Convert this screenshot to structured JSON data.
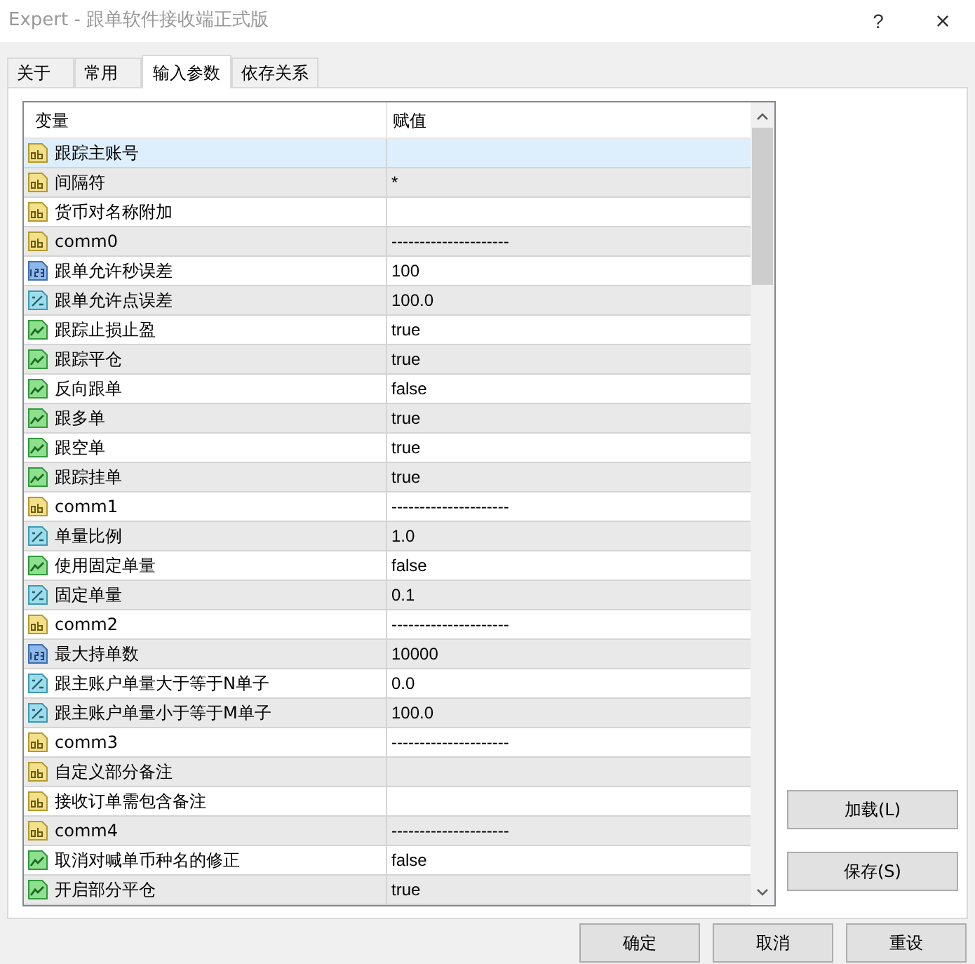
{
  "window": {
    "title": "Expert - 跟单软件接收端正式版",
    "help": "?",
    "close": "×"
  },
  "tabs": [
    {
      "label": "关于",
      "selected": false
    },
    {
      "label": "常用",
      "selected": false
    },
    {
      "label": "输入参数",
      "selected": true
    },
    {
      "label": "依存关系",
      "selected": false
    }
  ],
  "table": {
    "columns": [
      "变量",
      "赋值"
    ],
    "rows": [
      {
        "kind": "string",
        "name": "跟踪主账号",
        "value": "",
        "selected": true
      },
      {
        "kind": "string",
        "name": "间隔符",
        "value": "*",
        "selected": false
      },
      {
        "kind": "string",
        "name": "货币对名称附加",
        "value": "",
        "selected": false
      },
      {
        "kind": "string",
        "name": "comm0",
        "value": "---------------------",
        "selected": false
      },
      {
        "kind": "int",
        "name": "跟单允许秒误差",
        "value": "100",
        "selected": false
      },
      {
        "kind": "double",
        "name": "跟单允许点误差",
        "value": "100.0",
        "selected": false
      },
      {
        "kind": "bool",
        "name": "跟踪止损止盈",
        "value": "true",
        "selected": false
      },
      {
        "kind": "bool",
        "name": "跟踪平仓",
        "value": "true",
        "selected": false
      },
      {
        "kind": "bool",
        "name": "反向跟单",
        "value": "false",
        "selected": false
      },
      {
        "kind": "bool",
        "name": "跟多单",
        "value": "true",
        "selected": false
      },
      {
        "kind": "bool",
        "name": "跟空单",
        "value": "true",
        "selected": false
      },
      {
        "kind": "bool",
        "name": "跟踪挂单",
        "value": "true",
        "selected": false
      },
      {
        "kind": "string",
        "name": "comm1",
        "value": "---------------------",
        "selected": false
      },
      {
        "kind": "double",
        "name": "单量比例",
        "value": "1.0",
        "selected": false
      },
      {
        "kind": "bool",
        "name": "使用固定单量",
        "value": "false",
        "selected": false
      },
      {
        "kind": "double",
        "name": "固定单量",
        "value": "0.1",
        "selected": false
      },
      {
        "kind": "string",
        "name": "comm2",
        "value": "---------------------",
        "selected": false
      },
      {
        "kind": "int",
        "name": "最大持单数",
        "value": "10000",
        "selected": false
      },
      {
        "kind": "double",
        "name": "跟主账户单量大于等于N单子",
        "value": "0.0",
        "selected": false
      },
      {
        "kind": "double",
        "name": "跟主账户单量小于等于M单子",
        "value": "100.0",
        "selected": false
      },
      {
        "kind": "string",
        "name": "comm3",
        "value": "---------------------",
        "selected": false
      },
      {
        "kind": "string",
        "name": "自定义部分备注",
        "value": "",
        "selected": false
      },
      {
        "kind": "string",
        "name": "接收订单需包含备注",
        "value": "",
        "selected": false
      },
      {
        "kind": "string",
        "name": "comm4",
        "value": "---------------------",
        "selected": false
      },
      {
        "kind": "bool",
        "name": "取消对喊单币种名的修正",
        "value": "false",
        "selected": false
      },
      {
        "kind": "bool",
        "name": "开启部分平仓",
        "value": "true",
        "selected": false
      }
    ]
  },
  "side_buttons": [
    "加载(L)",
    "保存(S)"
  ],
  "footer_buttons": [
    "确定",
    "取消",
    "重设"
  ]
}
